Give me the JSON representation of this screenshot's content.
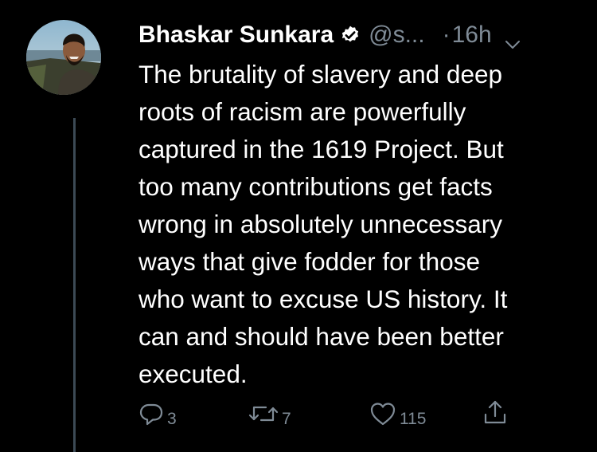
{
  "tweet": {
    "author": {
      "display_name": "Bhaskar Sunkara",
      "handle": "@s...",
      "verified": true
    },
    "separator": "·",
    "timestamp": "16h",
    "text": "The brutality of slavery and deep\nroots of racism are powerfully\ncaptured in the 1619 Project. But\ntoo many contributions get facts\nwrong in absolutely unnecessary\nways that give fodder for those\nwho want to excuse US history. It\ncan and should have been better\nexecuted.",
    "actions": {
      "reply_count": "3",
      "retweet_count": "7",
      "like_count": "115"
    }
  },
  "icons": {
    "verified": "verified-badge-icon",
    "more": "chevron-down-icon",
    "reply": "reply-icon",
    "retweet": "retweet-icon",
    "like": "heart-icon",
    "share": "share-icon"
  },
  "colors": {
    "background": "#000000",
    "primary_text": "#ffffff",
    "secondary_text": "#7f8b96",
    "thread_line": "#3c4a55"
  }
}
